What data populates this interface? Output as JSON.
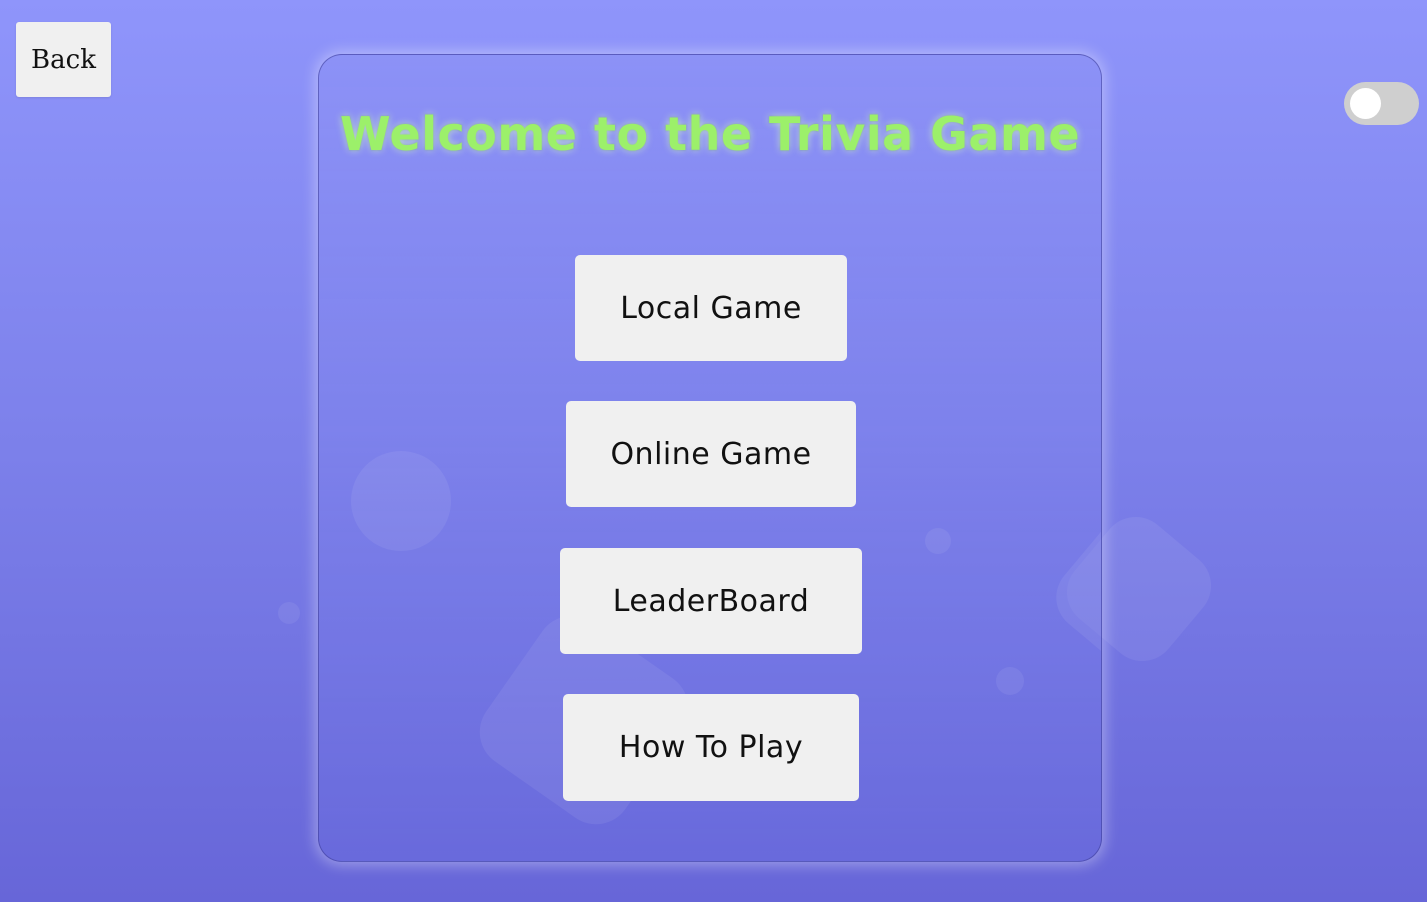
{
  "header": {
    "back_label": "Back"
  },
  "theme_toggle": {
    "state": "off"
  },
  "main": {
    "title": "Welcome to the Trivia Game",
    "menu": [
      {
        "label": "Local Game"
      },
      {
        "label": "Online Game"
      },
      {
        "label": "LeaderBoard"
      },
      {
        "label": "How To Play"
      }
    ]
  },
  "colors": {
    "background_top": "#8f95fb",
    "background_bottom": "#6766d8",
    "title": "#9cf06a",
    "button": "#f0f0f0",
    "toggle_track": "#cfcfcf"
  }
}
